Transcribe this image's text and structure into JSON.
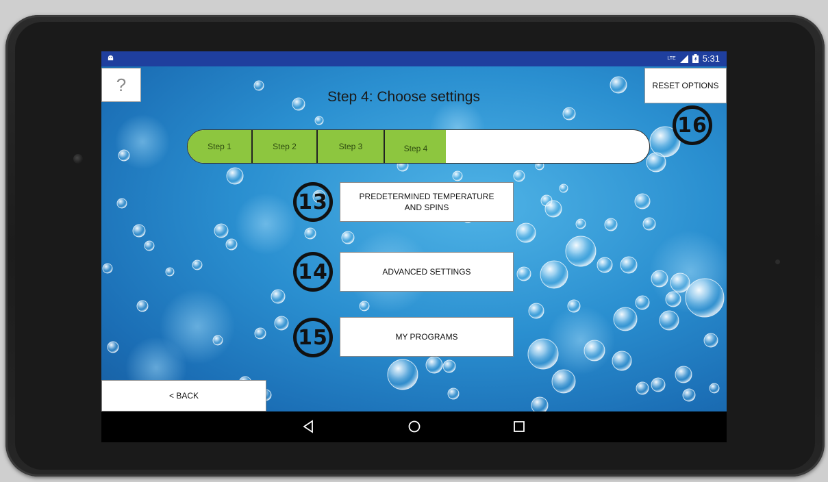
{
  "status_bar": {
    "time": "5:31",
    "network_label": "LTE",
    "icons": [
      "android-icon",
      "signal-icon",
      "battery-icon"
    ]
  },
  "header": {
    "help_label": "?",
    "title": "Step 4: Choose settings",
    "reset_label": "RESET OPTIONS"
  },
  "progress": {
    "steps": [
      "Step 1",
      "Step 2",
      "Step 3",
      "Step 4"
    ],
    "completed_fraction": 0.56,
    "fill_color": "#8dc63f"
  },
  "menu": {
    "items": [
      {
        "label": "PREDETERMINED TEMPERATURE AND SPINS",
        "badge": "13"
      },
      {
        "label": "ADVANCED SETTINGS",
        "badge": "14"
      },
      {
        "label": "MY PROGRAMS",
        "badge": "15"
      }
    ]
  },
  "reset_badge": "16",
  "footer": {
    "back_label": "< BACK"
  },
  "navbar": {
    "icons": [
      "back-triangle-icon",
      "home-circle-icon",
      "recents-square-icon"
    ]
  },
  "colors": {
    "status_bar": "#1f3f9e",
    "background": "#2a8fd0",
    "progress_fill": "#8dc63f"
  }
}
